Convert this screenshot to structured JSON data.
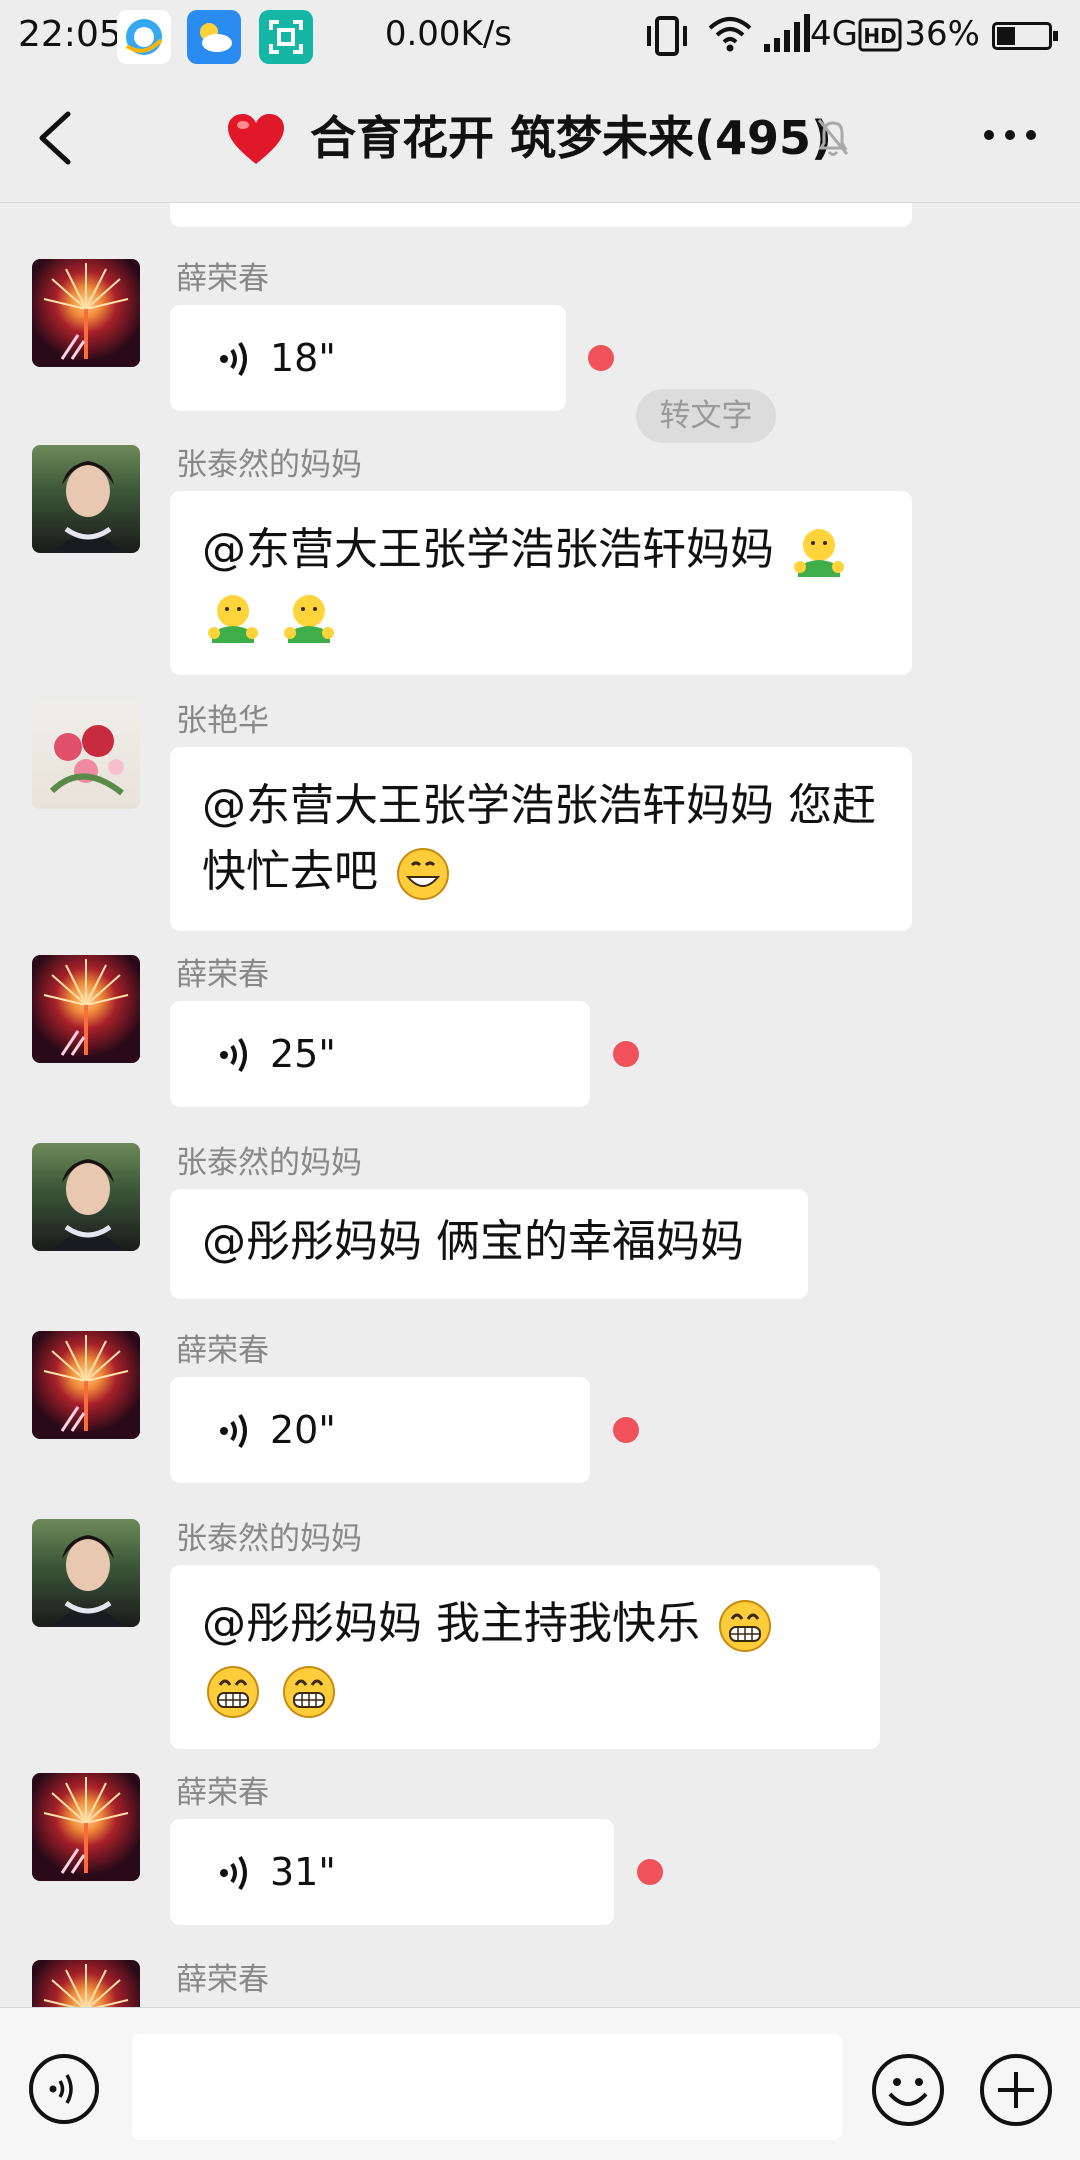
{
  "status_bar": {
    "time": "22:05",
    "net_speed": "0.00K/s",
    "network_type": "4G",
    "battery": "36%",
    "battery_level": 0.36,
    "icons": [
      "qq-browser-icon",
      "weather-icon",
      "scan-icon",
      "vibrate-icon",
      "wifi-icon",
      "signal-icon",
      "hd-icon",
      "battery-icon"
    ]
  },
  "header": {
    "title": "合育花开 筑梦未来(495)",
    "title_emoji": "heart-icon",
    "muted": true
  },
  "messages": [
    {
      "type": "voice",
      "sender": "薛荣春",
      "avatar": "fireworks",
      "duration": "18\"",
      "unread": true,
      "transcribe_label": "转文字"
    },
    {
      "type": "text",
      "sender": "张泰然的妈妈",
      "avatar": "woman",
      "text": "@东营大王张学浩张浩轩妈妈 ",
      "emojis": [
        "hug-emoji",
        "hug-emoji",
        "hug-emoji"
      ]
    },
    {
      "type": "text",
      "sender": "张艳华",
      "avatar": "flowers",
      "text": "@东营大王张学浩张浩轩妈妈  您赶快忙去吧",
      "emojis": [
        "grin-emoji"
      ]
    },
    {
      "type": "voice",
      "sender": "薛荣春",
      "avatar": "fireworks",
      "duration": "25\"",
      "unread": true
    },
    {
      "type": "text",
      "sender": "张泰然的妈妈",
      "avatar": "woman",
      "text": "@彤彤妈妈  俩宝的幸福妈妈"
    },
    {
      "type": "voice",
      "sender": "薛荣春",
      "avatar": "fireworks",
      "duration": "20\"",
      "unread": true
    },
    {
      "type": "text",
      "sender": "张泰然的妈妈",
      "avatar": "woman",
      "text": "@彤彤妈妈  我主持我快乐",
      "emojis": [
        "laugh-emoji",
        "laugh-emoji",
        "laugh-emoji"
      ]
    },
    {
      "type": "voice",
      "sender": "薛荣春",
      "avatar": "fireworks",
      "duration": "31\"",
      "unread": true
    },
    {
      "type": "partial",
      "sender": "薛荣春",
      "avatar": "fireworks"
    }
  ],
  "input": {
    "value": "",
    "placeholder": ""
  }
}
